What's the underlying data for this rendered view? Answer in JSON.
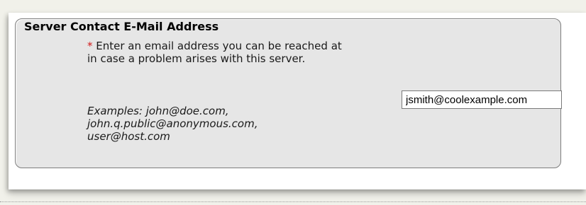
{
  "section": {
    "title": "Server Contact E-Mail Address"
  },
  "field": {
    "required_marker": "*",
    "description": "Enter an email address you can be reached at in case a problem arises with this server.",
    "examples_line1": "Examples: john@doe.com,",
    "examples_line2": "john.q.public@anonymous.com,",
    "examples_line3": "user@host.com",
    "value": "jsmith@coolexample.com"
  }
}
